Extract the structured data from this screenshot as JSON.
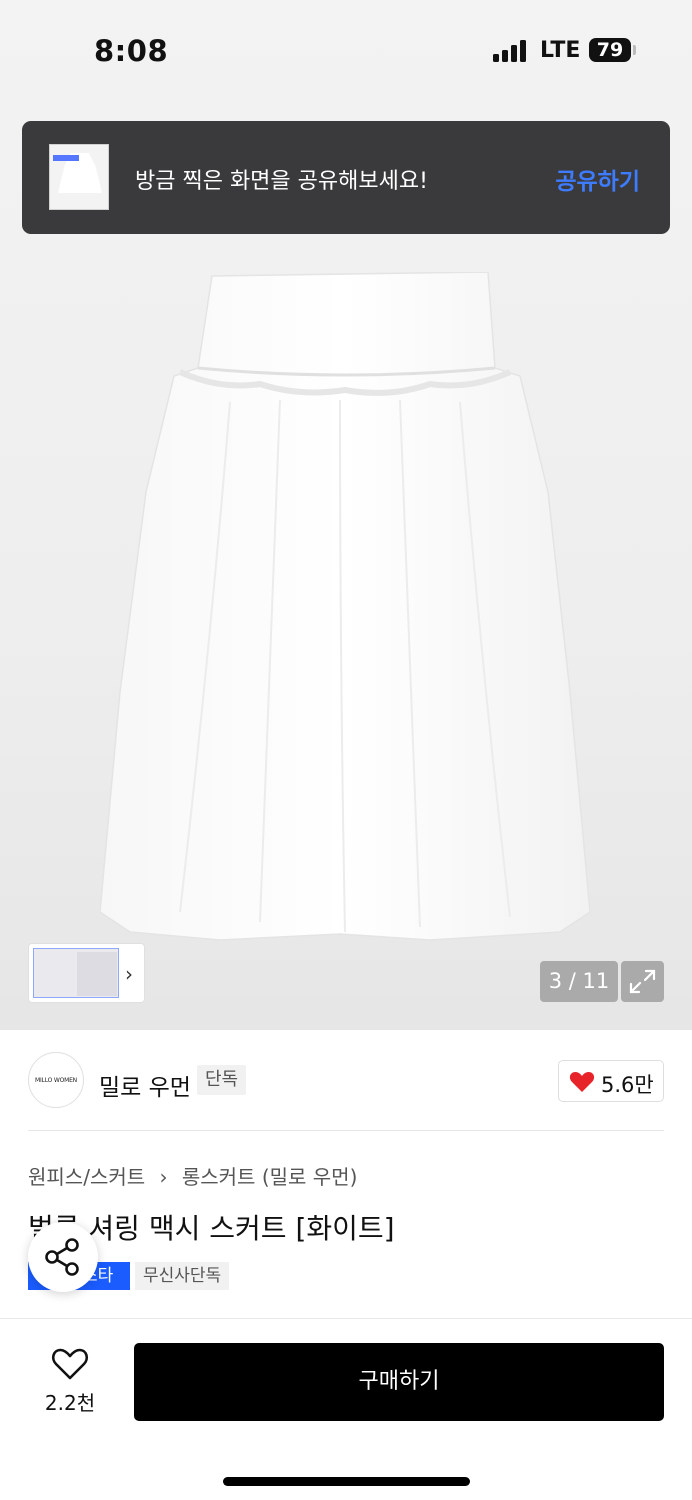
{
  "status_bar": {
    "time": "8:08",
    "network": "LTE",
    "battery": "79"
  },
  "share_banner": {
    "message": "방금 찍은 화면을 공유해보세요!",
    "action": "공유하기"
  },
  "gallery": {
    "counter": "3 / 11",
    "thumbnail_chevron": "›"
  },
  "brand": {
    "logo_text": "MILLO WOMEN",
    "name": "밀로 우먼",
    "badge": "단독",
    "likes": "5.6만"
  },
  "breadcrumb": {
    "category": "원피스/스커트",
    "separator": "›",
    "subcategory": "롱스커트 (밀로 우먼)"
  },
  "product": {
    "title": "벌룬 셔링 맥시 스커트 [화이트]",
    "tags": [
      "스타",
      "무신사단독"
    ]
  },
  "bottom_bar": {
    "wish_count": "2.2천",
    "buy_label": "구매하기"
  },
  "colors": {
    "accent_blue": "#3d7bff",
    "tag_blue": "#1a5cff",
    "heart_red": "#e8242b",
    "banner_bg": "#3a3a3c"
  },
  "icons": [
    "signal-icon",
    "battery-icon",
    "chevron-right-icon",
    "expand-icon",
    "heart-filled-icon",
    "share-icon",
    "heart-outline-icon"
  ]
}
